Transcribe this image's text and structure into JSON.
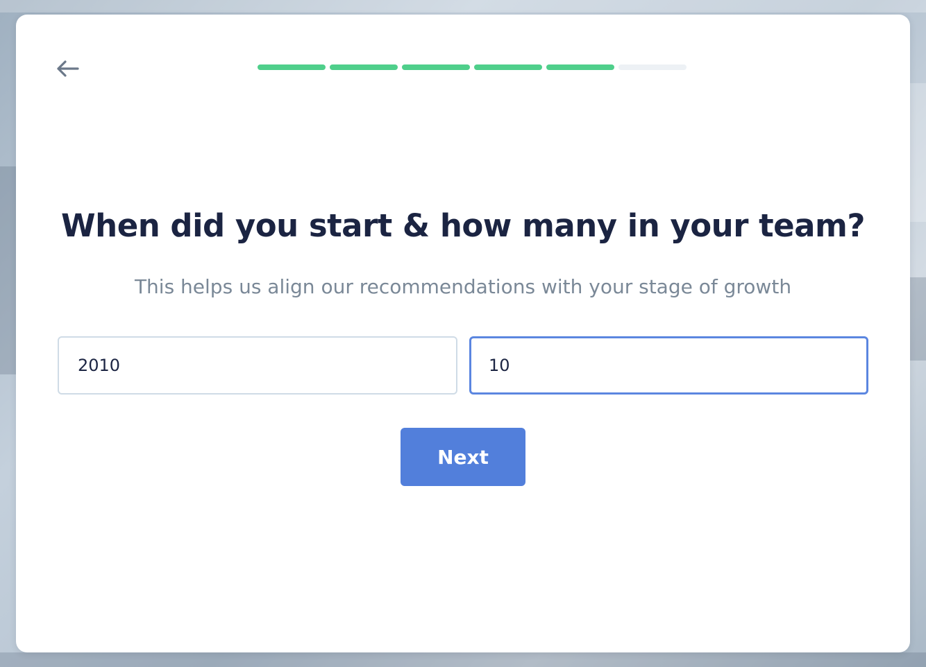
{
  "navigation": {
    "back_icon": "arrow-left-icon"
  },
  "progress": {
    "total_steps": 6,
    "completed_steps": 5,
    "completed_color": "#4fcf8b",
    "remaining_color": "#edf1f5"
  },
  "question": {
    "title": "When did you start & how many in your team?",
    "subtitle": "This helps us align our recommendations with your stage of growth"
  },
  "fields": {
    "start_year": {
      "value": "2010"
    },
    "team_size": {
      "value": "10"
    }
  },
  "actions": {
    "next_label": "Next",
    "next_color": "#527fdb"
  }
}
